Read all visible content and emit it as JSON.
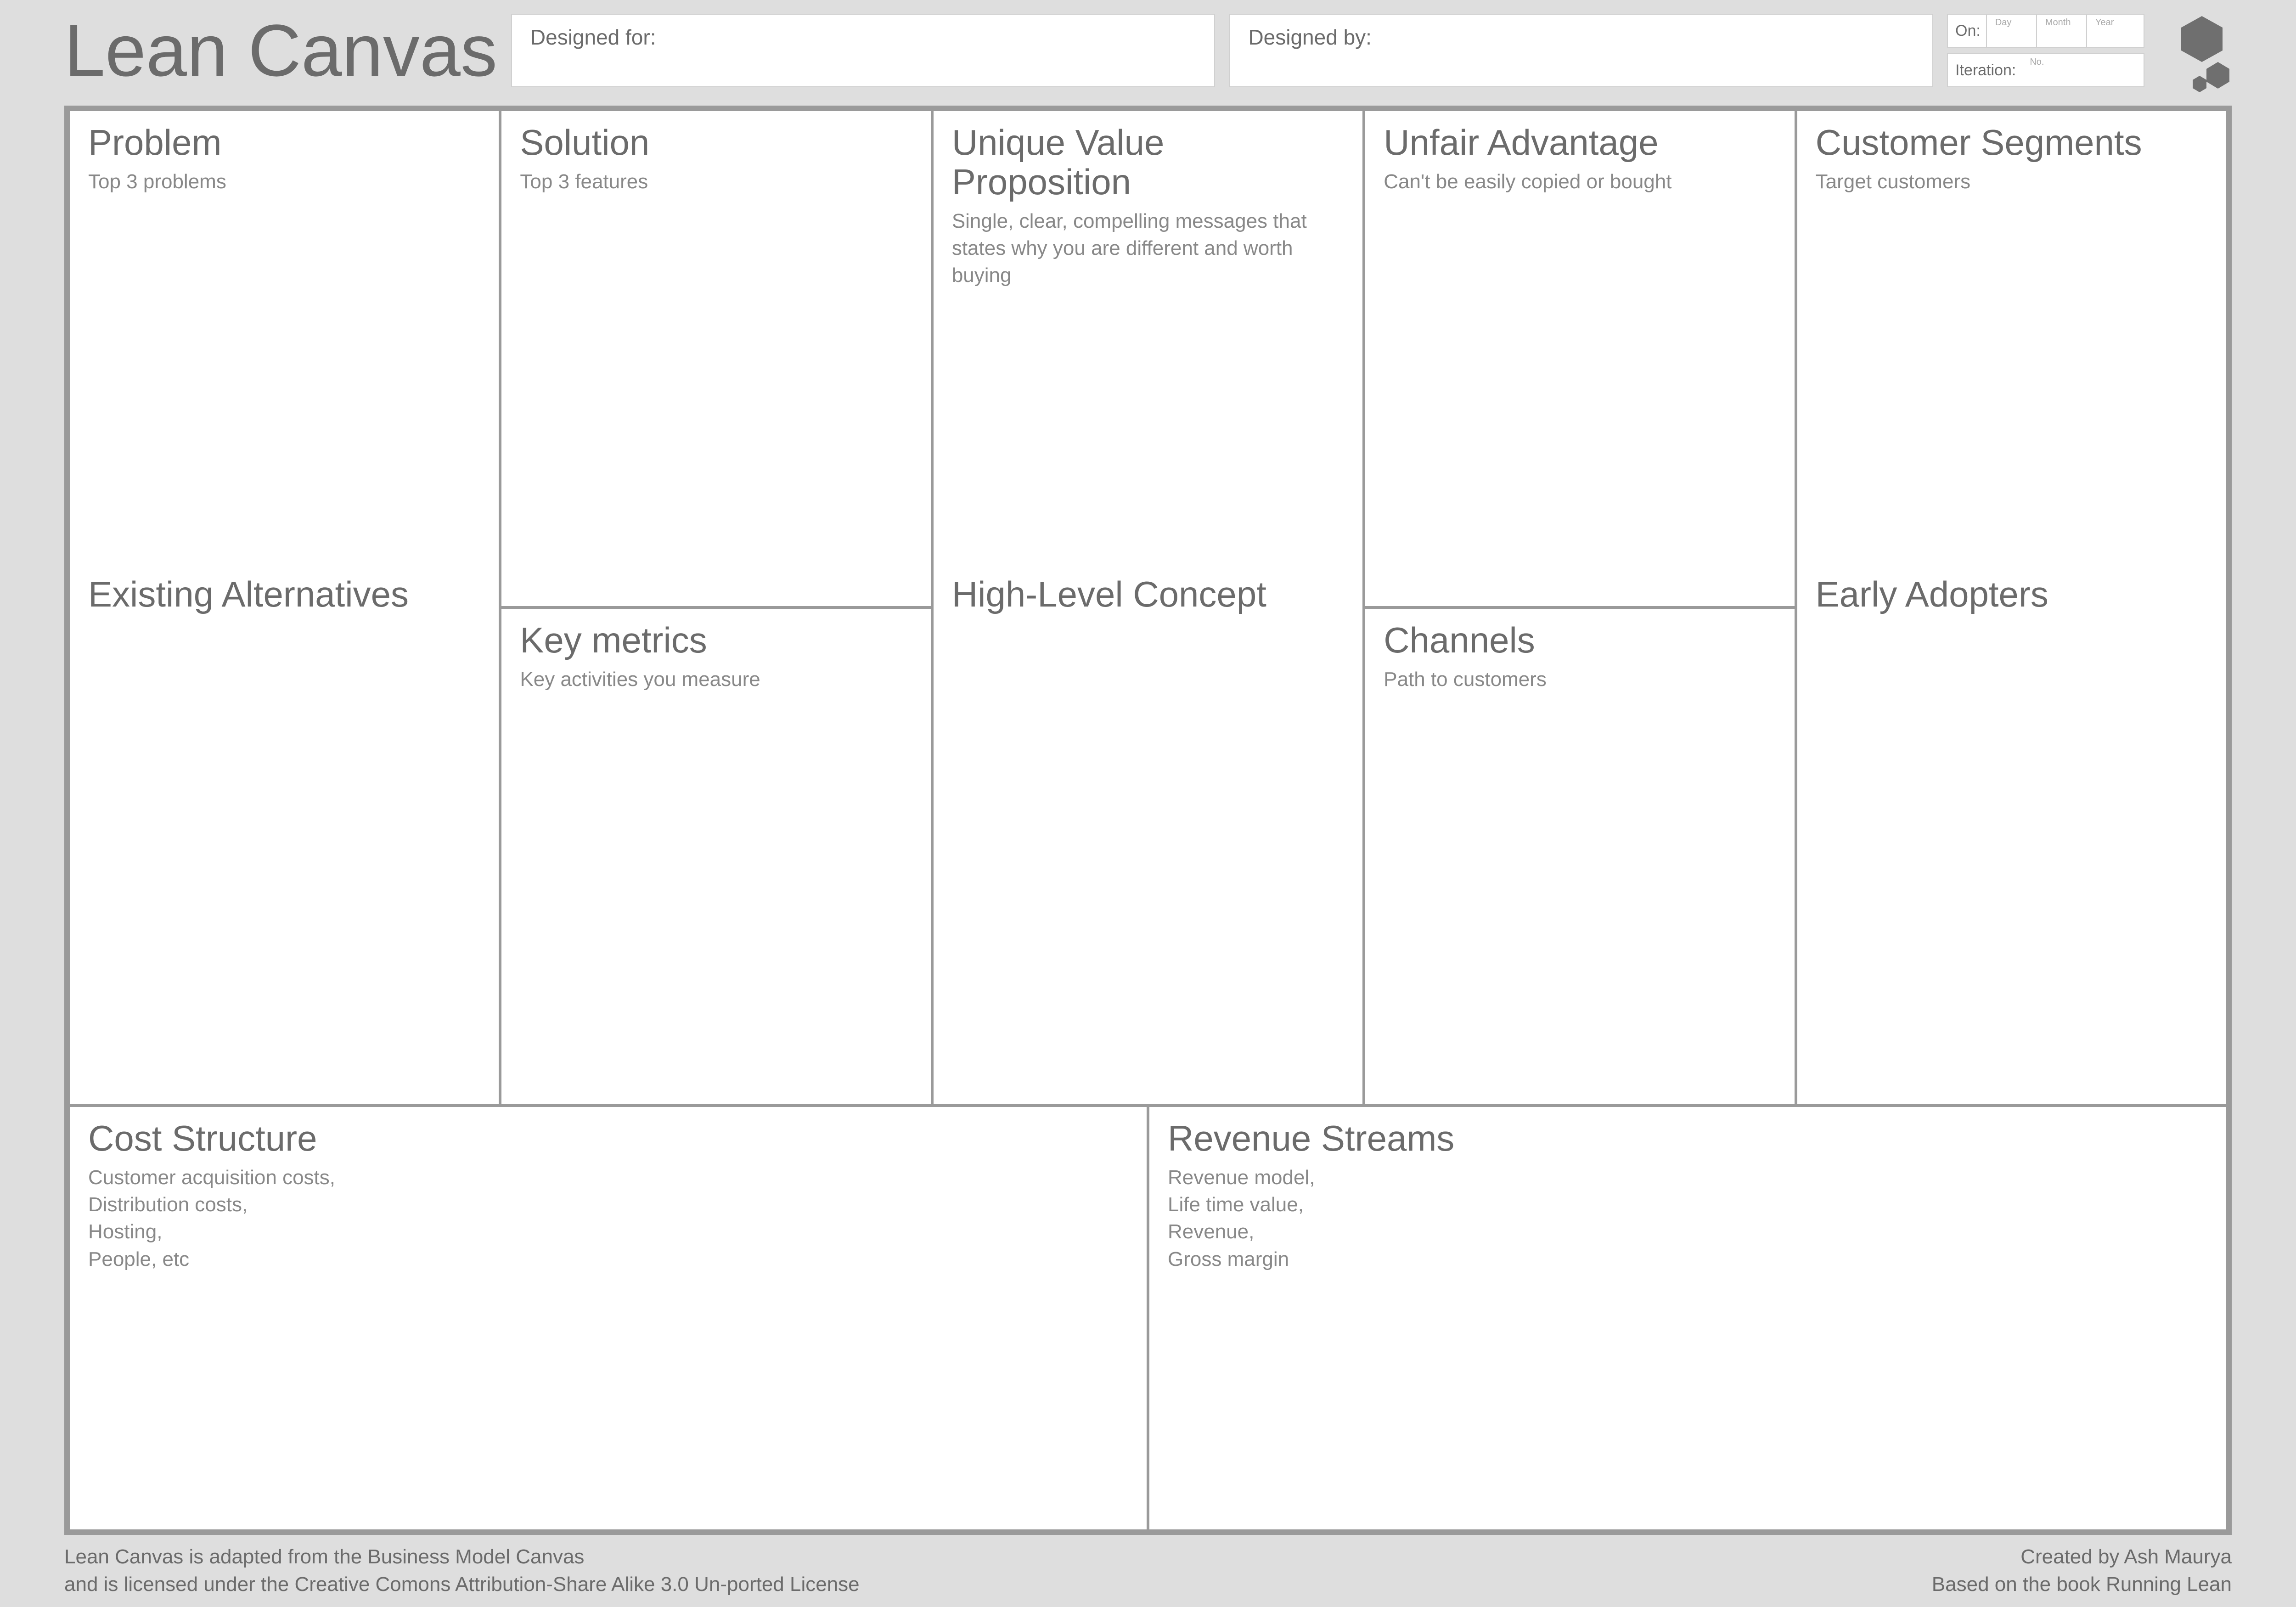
{
  "header": {
    "title": "Lean Canvas",
    "designed_for_label": "Designed for:",
    "designed_by_label": "Designed by:",
    "on_label": "On:",
    "on_day": "Day",
    "on_month": "Month",
    "on_year": "Year",
    "iteration_label": "Iteration:",
    "iteration_no": "No."
  },
  "cells": {
    "problem": {
      "title": "Problem",
      "desc": "Top 3 problems",
      "sub": "Existing Alternatives"
    },
    "solution": {
      "title": "Solution",
      "desc": "Top 3 features"
    },
    "keymetrics": {
      "title": "Key metrics",
      "desc": "Key activities you measure"
    },
    "uvp": {
      "title": "Unique Value Proposition",
      "desc": "Single, clear, compelling messages that states why you are different and worth buying",
      "sub": "High-Level Concept"
    },
    "unfair": {
      "title": "Unfair Advantage",
      "desc": "Can't be easily copied or bought"
    },
    "channels": {
      "title": "Channels",
      "desc": "Path to customers"
    },
    "segments": {
      "title": "Customer Segments",
      "desc": "Target customers",
      "sub": "Early Adopters"
    },
    "cost": {
      "title": "Cost Structure",
      "desc": "Customer acquisition costs,\nDistribution costs,\nHosting,\nPeople, etc"
    },
    "revenue": {
      "title": "Revenue Streams",
      "desc": "Revenue model,\nLife time value,\nRevenue,\nGross margin"
    }
  },
  "footer": {
    "left": "Lean Canvas is adapted from the Business Model Canvas\nand is licensed under the Creative Comons Attribution-Share Alike 3.0 Un-ported License",
    "right": "Created by Ash Maurya\nBased on the book Running Lean"
  }
}
